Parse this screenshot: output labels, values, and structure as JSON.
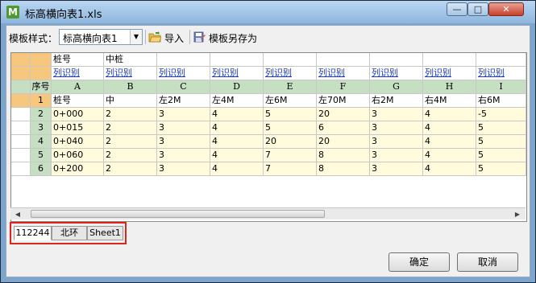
{
  "window": {
    "title": "标高横向表1.xls",
    "app_icon_letter": "M",
    "minimize_glyph": "—",
    "maximize_glyph": "□",
    "close_glyph": "✕"
  },
  "toolbar": {
    "template_label": "模板样式：",
    "template_value": "标高横向表1",
    "dropdown_glyph": "▼",
    "import_label": "导入",
    "save_as_label": "模板另存为"
  },
  "grid": {
    "header_row1": [
      "",
      "桩号",
      "中桩",
      "",
      "",
      "",
      "",
      "",
      "",
      ""
    ],
    "header_row2": [
      "",
      "列识别",
      "列识别",
      "列识别",
      "列识别",
      "列识别",
      "列识别",
      "列识别",
      "列识别",
      "列识别"
    ],
    "columns": [
      "序号",
      "A",
      "B",
      "C",
      "D",
      "E",
      "F",
      "G",
      "H",
      "I"
    ],
    "rows": [
      [
        "1",
        "桩号",
        "中",
        "左2M",
        "左4M",
        "左6M",
        "左70M",
        "右2M",
        "右4M",
        "右6M"
      ],
      [
        "2",
        "0+000",
        "2",
        "3",
        "4",
        "5",
        "20",
        "3",
        "4",
        "-5"
      ],
      [
        "3",
        "0+015",
        "2",
        "3",
        "4",
        "5",
        "6",
        "3",
        "4",
        "5"
      ],
      [
        "4",
        "0+040",
        "2",
        "3",
        "4",
        "20",
        "20",
        "3",
        "4",
        "5"
      ],
      [
        "5",
        "0+060",
        "2",
        "3",
        "4",
        "7",
        "8",
        "3",
        "4",
        "5"
      ],
      [
        "6",
        "0+200",
        "2",
        "3",
        "4",
        "7",
        "8",
        "3",
        "4",
        "5"
      ]
    ],
    "scroll_left_glyph": "◀",
    "scroll_right_glyph": "▶"
  },
  "sheet_tabs": [
    "112244",
    "北环",
    "Sheet1"
  ],
  "buttons": {
    "ok": "确定",
    "cancel": "取消"
  },
  "colors": {
    "row_header_green": "#c6dfc3",
    "corner_orange": "#f6c77d",
    "data_yellow": "#fffbdc",
    "link_blue": "#1c3cc7",
    "highlight_red": "#e0241b"
  }
}
